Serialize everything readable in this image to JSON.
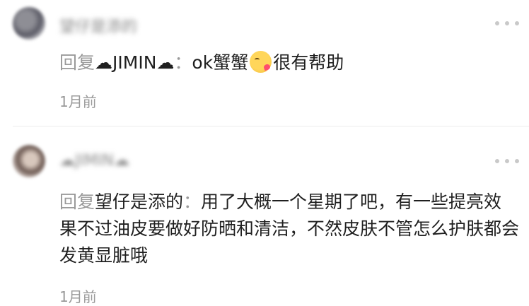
{
  "comments": [
    {
      "username": "望仔是添的",
      "reply_prefix": "回复",
      "reply_target": "☁JIMIN☁",
      "colon": "：",
      "text_before_emoji": "ok蟹蟹",
      "emoji": "kissing-face-emoji",
      "text_after_emoji": "很有帮助",
      "time": "1月前"
    },
    {
      "username": "☁JIMIN☁",
      "reply_prefix": "回复",
      "reply_target": "望仔是添的",
      "colon": "：",
      "text": "用了大概一个星期了吧，有一些提亮效果不过油皮要做好防晒和清洁，不然皮肤不管怎么护肤都会发黄显脏哦",
      "time": "1月前"
    }
  ],
  "colors": {
    "accent_gray": "#9a9a9a",
    "text": "#1f1f1f",
    "divider": "#ececec"
  }
}
